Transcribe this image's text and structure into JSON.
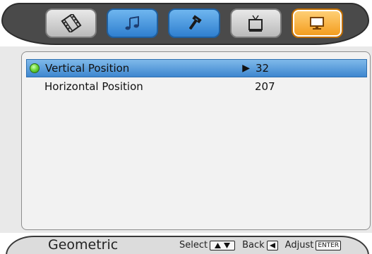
{
  "osd": {
    "tabs": [
      {
        "name": "film-icon",
        "style": "gray"
      },
      {
        "name": "music-note-icon",
        "style": "blue"
      },
      {
        "name": "wrench-icon",
        "style": "blue"
      },
      {
        "name": "tv-icon",
        "style": "gray"
      },
      {
        "name": "monitor-icon",
        "style": "orange",
        "selected": true
      }
    ],
    "menu": {
      "rows": [
        {
          "label": "Vertical Position",
          "value": "32",
          "selected": true
        },
        {
          "label": "Horizontal Position",
          "value": "207",
          "selected": false
        }
      ]
    },
    "footer": {
      "title": "Geometric",
      "select_label": "Select",
      "back_label": "Back",
      "adjust_label": "Adjust",
      "enter_key": "ENTER"
    }
  },
  "colors": {
    "selected_row": "#3e87cf",
    "active_tab": "#f39a1a",
    "blue_tab": "#2f7fcf",
    "gray_tab": "#b9b9b9"
  }
}
